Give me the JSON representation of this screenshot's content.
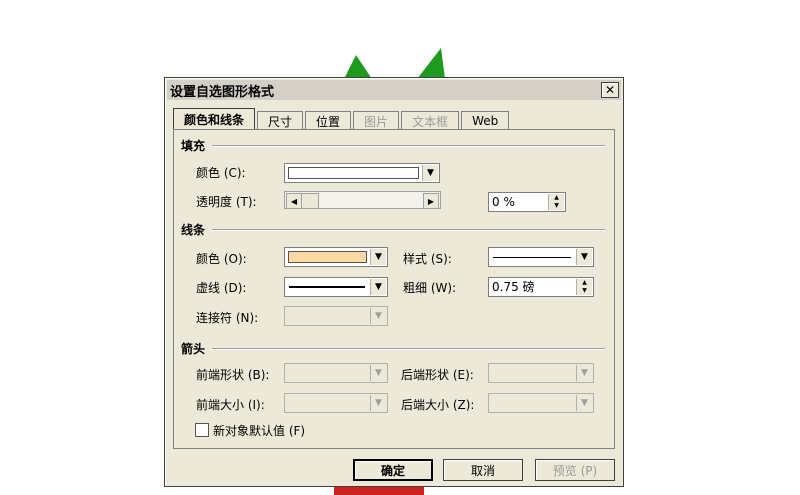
{
  "dialog": {
    "title": "设置自选图形格式",
    "close_glyph": "✕"
  },
  "tabs": [
    {
      "label": "颜色和线条",
      "state": "active"
    },
    {
      "label": "尺寸",
      "state": "enabled"
    },
    {
      "label": "位置",
      "state": "enabled"
    },
    {
      "label": "图片",
      "state": "disabled"
    },
    {
      "label": "文本框",
      "state": "disabled"
    },
    {
      "label": "Web",
      "state": "enabled"
    }
  ],
  "fill": {
    "section": "填充",
    "color_label": "颜色 (C):",
    "color_value": "#ffffff",
    "transparency_label": "透明度 (T):",
    "transparency_value": "0 %",
    "transparency_percent": 0
  },
  "line": {
    "section": "线条",
    "color_label": "颜色 (O):",
    "color_value": "#fcd9a0",
    "style_label": "样式 (S):",
    "dash_label": "虚线 (D):",
    "weight_label": "粗细 (W):",
    "weight_value": "0.75 磅",
    "connector_label": "连接符 (N):"
  },
  "arrows": {
    "section": "箭头",
    "begin_style_label": "前端形状 (B):",
    "end_style_label": "后端形状 (E):",
    "begin_size_label": "前端大小 (I):",
    "end_size_label": "后端大小 (Z):"
  },
  "default_checkbox_label": "新对象默认值 (F)",
  "buttons": {
    "ok": "确定",
    "cancel": "取消",
    "preview": "预览 (P)"
  },
  "icons": {
    "combo_arrow": "▼",
    "scroll_left": "◀",
    "scroll_right": "▶",
    "spin_up": "▲",
    "spin_down": "▼"
  }
}
